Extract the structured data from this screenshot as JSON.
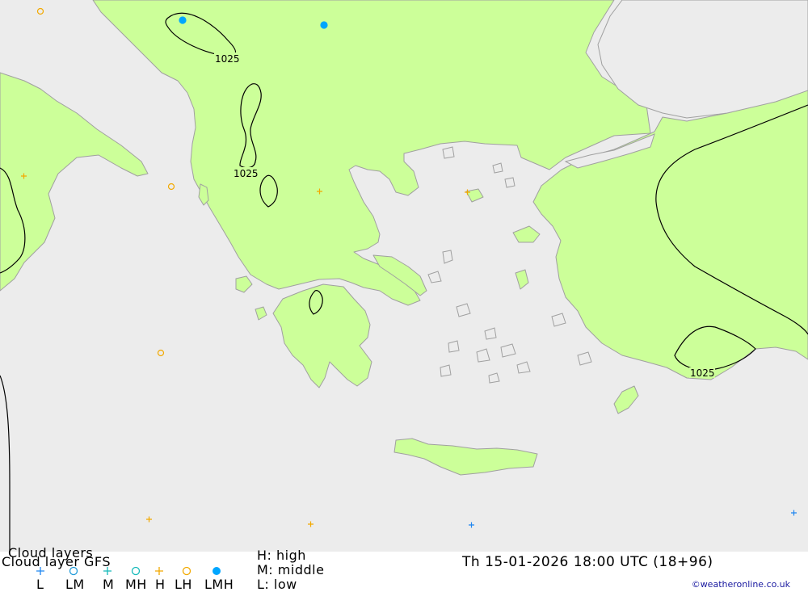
{
  "map": {
    "isobar_label": "1025",
    "colors": {
      "sea": "#ececec",
      "land": "#ccff99",
      "coast": "#a0a0a0",
      "isobar": "#000000",
      "high_cloud": "#f2a900",
      "mid_cloud": "#15b9b9",
      "low_cloud": "#1f86f0",
      "lmh_cloud": "#00a6ff"
    }
  },
  "legend": {
    "title_primary": "Cloud layers",
    "title_secondary": "Cloud layer   GFS",
    "symbols": [
      {
        "label": "L",
        "icon": "plus-icon",
        "color": "#1f86f0"
      },
      {
        "label": "LM",
        "icon": "circle-icon",
        "color": "#1f9ad8"
      },
      {
        "label": "M",
        "icon": "plus-icon",
        "color": "#15b9b9"
      },
      {
        "label": "MH",
        "icon": "circle-icon",
        "color": "#15b9b9"
      },
      {
        "label": "H",
        "icon": "plus-icon",
        "color": "#f2a900"
      },
      {
        "label": "LH",
        "icon": "circle-icon",
        "color": "#f2a900"
      },
      {
        "label": "LMH",
        "icon": "filled-circle-icon",
        "color": "#00a6ff"
      }
    ],
    "key_high": "H:  high",
    "key_middle": "M:  middle",
    "key_low": "L:  low",
    "datetime": "Th  15-01-2026  18:00  UTC  (18+96)",
    "credit": "©weatheronline.co.uk"
  }
}
